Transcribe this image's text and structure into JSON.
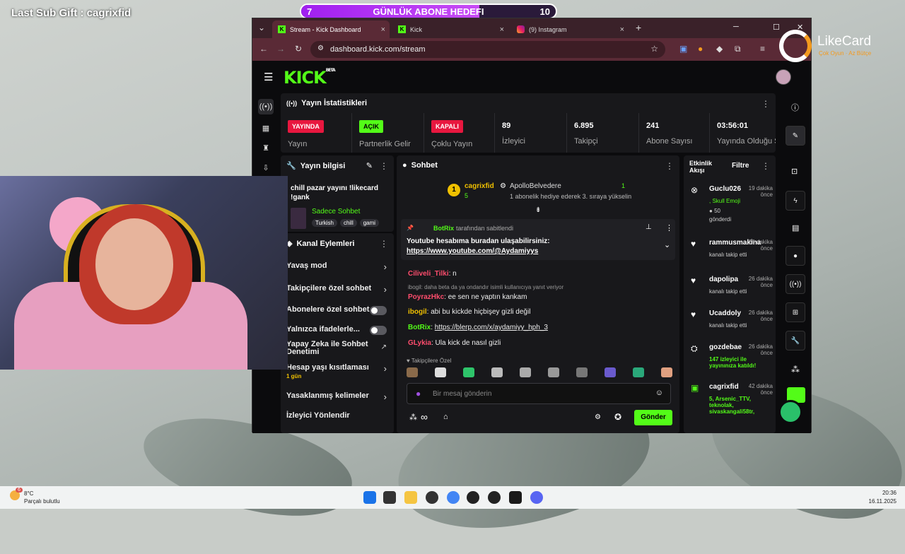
{
  "overlay": {
    "sub_gift": "Last Sub Gift : cagrixfid",
    "goal": {
      "current": "7",
      "title": "GÜNLÜK ABONE HEDEFI",
      "target": "10",
      "progress": 0.7
    },
    "sponsor": {
      "name": "LikeCard",
      "tagline": "Çok Oyun · Az Bütçe"
    }
  },
  "browser": {
    "tabs": [
      {
        "label": "Stream - Kick Dashboard",
        "icon": "kick-icon"
      },
      {
        "label": "Kick",
        "icon": "kick-icon"
      },
      {
        "label": "(9) Instagram",
        "icon": "instagram-icon"
      }
    ],
    "new_tab": "+",
    "url": "dashboard.kick.com/stream"
  },
  "kick": {
    "logo": "KICK",
    "logo_sup": "BETA",
    "stats": {
      "title": "Yayın İstatistikleri",
      "items": [
        {
          "badge": "YAYINDA",
          "label": "Yayın",
          "color": "#e8173f"
        },
        {
          "badge": "AÇIK",
          "label": "Partnerlik Gelir",
          "color": "#53fc18"
        },
        {
          "badge": "KAPALI",
          "label": "Çoklu Yayın",
          "color": "#e8173f"
        },
        {
          "value": "89",
          "label": "İzleyici"
        },
        {
          "value": "6.895",
          "label": "Takipçi"
        },
        {
          "value": "241",
          "label": "Abone Sayısı"
        },
        {
          "value": "03:56:01",
          "label": "Yayında Olduğu Süre"
        }
      ]
    },
    "stream_info": {
      "title": "Yayın bilgisi",
      "stream_title": "chill pazar yayını !likecard !gank",
      "category": "Sadece Sohbet",
      "tags": [
        "Turkish",
        "chill",
        "gami"
      ]
    },
    "channel_actions": {
      "title": "Kanal Eylemleri",
      "items": [
        {
          "label": "Yavaş mod",
          "type": "chevron"
        },
        {
          "label": "Takipçilere özel sohbet",
          "type": "chevron"
        },
        {
          "label": "Abonelere özel sohbet",
          "type": "toggle"
        },
        {
          "label": "Yalnızca ifadelerle...",
          "type": "toggle"
        },
        {
          "label": "Yapay Zeka ile Sohbet Denetimi",
          "type": "external"
        },
        {
          "label": "Hesap yaşı kısıtlaması",
          "sub": "1 gün",
          "type": "chevron"
        },
        {
          "label": "Yasaklanmış kelimeler",
          "type": "chevron"
        },
        {
          "label": "İzleyici Yönlendir",
          "type": "none"
        }
      ]
    },
    "chat": {
      "title": "Sohbet",
      "top_gifter": {
        "rank": "1",
        "name": "cagrixfid",
        "count": "5"
      },
      "gift_user": {
        "name": "ApolloBelvedere",
        "count": "1"
      },
      "gift_text": "1 abonelik hediye ederek 3. sıraya yükselin",
      "pinned_by": "BotRix",
      "pinned_label": "tarafından sabitlendi",
      "pinned_text": "Youtube hesabıma buradan ulaşabilirsiniz:",
      "pinned_link": "https://www.youtube.com/@Aydamiyys",
      "messages": [
        {
          "user": "Ciliveli_Tilki",
          "color": "#ff4d6d",
          "text": ": n"
        },
        {
          "reply": "ibogil: daha beta da ya ondandır isimli kullanıcıya yanıt veriyor"
        },
        {
          "user": "PoyrazHkc",
          "color": "#ff4d6d",
          "text": ": ee sen ne yaptın kankam"
        },
        {
          "user": "ibogil",
          "color": "#f0c000",
          "text": ": abi bu kickde hiçbişey gizli değil"
        },
        {
          "user": "BotRix",
          "color": "#53fc18",
          "text": ": ",
          "link": "https://blerp.com/x/aydamiyy_hph_3"
        },
        {
          "user": "GLykia",
          "color": "#ff4d6d",
          "text": ": Ula kick de nasıl gizli"
        }
      ],
      "emote_section": "Takipçilere Özel",
      "input_placeholder": "Bir mesaj gönderin",
      "send": "Gönder",
      "infinity": "∞"
    },
    "events": {
      "title": "Etkinlik Akışı",
      "filter": "Filtre",
      "items": [
        {
          "name": "Guclu026",
          "time": "19 dakika önce",
          "desc": ", Skull Emoji",
          "desc2": "50",
          "desc3": "gönderdi",
          "icon": "kick-coin-icon"
        },
        {
          "name": "rammusmakina",
          "time": "26 dakika önce",
          "desc": "kanalı takip etti",
          "icon": "heart-icon"
        },
        {
          "name": "dapolipa",
          "time": "26 dakika önce",
          "desc": "kanalı takip etti",
          "icon": "heart-icon"
        },
        {
          "name": "Ucaddoly",
          "time": "26 dakika önce",
          "desc": "kanalı takip etti",
          "icon": "heart-icon"
        },
        {
          "name": "gozdebae",
          "time": "26 dakika önce",
          "desc": "147 izleyici ile yayınınıza katıldı!",
          "icon": "raid-icon"
        },
        {
          "name": "cagrixfid",
          "time": "42 dakika önce",
          "desc": "5, Arsenic_TTV, teknolak, sivaskangali58tr,",
          "icon": "gift-icon"
        }
      ]
    }
  },
  "taskbar": {
    "weather_temp": "8°C",
    "weather_desc": "Parçalı bulutlu",
    "weather_badge": "6",
    "time": "20:36",
    "date": "16.11.2025"
  }
}
